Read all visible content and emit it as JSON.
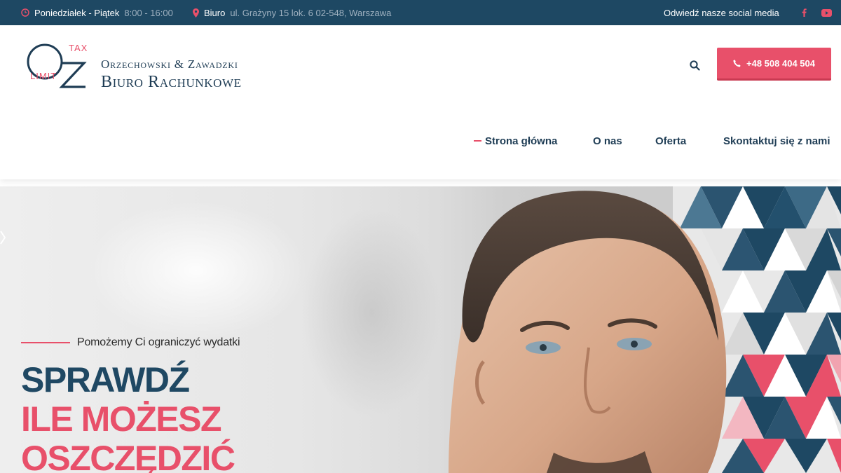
{
  "topbar": {
    "hours_label": "Poniedziałek - Piątek",
    "hours_value": "8:00 - 16:00",
    "office_label": "Biuro",
    "office_address": "ul. Grażyny 15 lok. 6 02-548, Warszawa",
    "social_label": "Odwiedź nasze social media",
    "icons": [
      "clock-icon",
      "map-pin-icon",
      "facebook-icon",
      "youtube-icon"
    ]
  },
  "logo": {
    "mark_top": "TAX",
    "mark_bottom": "LIMIT",
    "line1": "Orzechowski & Zawadzki",
    "line2": "Biuro Rachunkowe"
  },
  "header": {
    "search_icon": "search-icon",
    "phone_label": "+48 508 404 504",
    "phone_icon": "phone-icon"
  },
  "nav": {
    "items": [
      {
        "label": "Strona główna",
        "active": true
      },
      {
        "label": "O nas",
        "active": false
      },
      {
        "label": "Oferta",
        "active": false
      },
      {
        "label": "Skontaktuj się z nami",
        "active": false
      }
    ]
  },
  "hero": {
    "eyebrow": "Pomożemy Ci ograniczyć wydatki",
    "headline_1": "SPRAWDŹ",
    "headline_2": "ILE MOŻESZ",
    "headline_3": "OSZCZĘDZIĆ"
  },
  "colors": {
    "navy": "#1e4863",
    "accent": "#e8506a",
    "text_dark": "#1f3d55"
  }
}
